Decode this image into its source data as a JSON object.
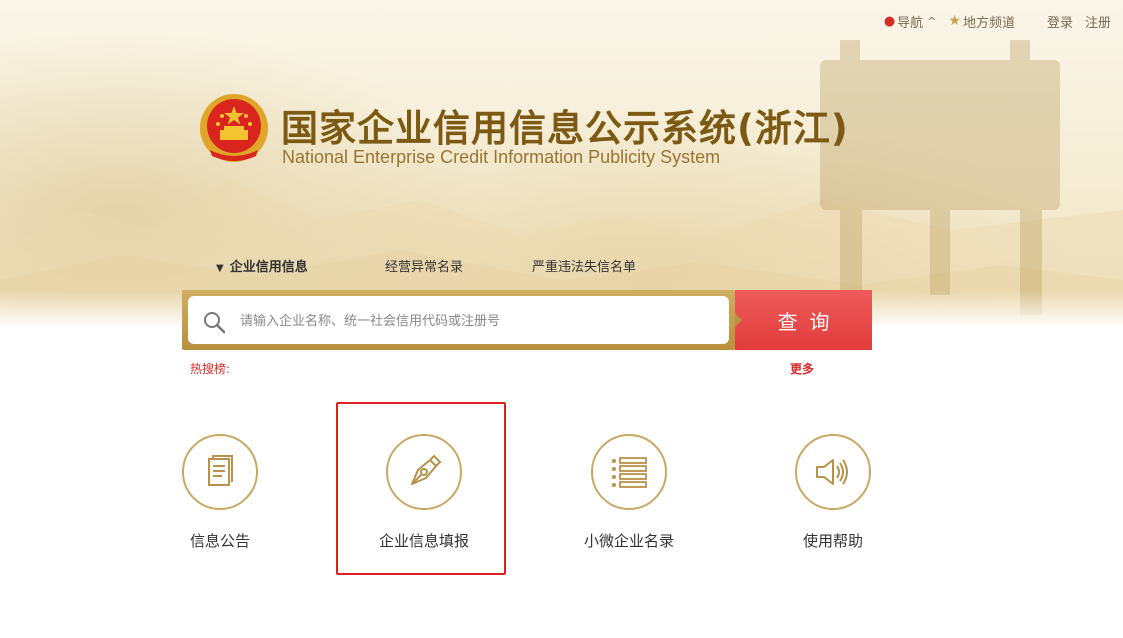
{
  "topbar": {
    "nav": "导航",
    "local": "地方频道",
    "login": "登录",
    "register": "注册"
  },
  "header": {
    "title_cn": "国家企业信用信息公示系统(浙江)",
    "title_en": "National Enterprise Credit Information Publicity System"
  },
  "tabs": [
    {
      "label": "企业信用信息",
      "active": true
    },
    {
      "label": "经营异常名录",
      "active": false
    },
    {
      "label": "严重违法失信名单",
      "active": false
    }
  ],
  "search": {
    "placeholder": "请输入企业名称、统一社会信用代码或注册号",
    "button": "查询"
  },
  "hot": {
    "label": "热搜榜:",
    "more": "更多"
  },
  "features": [
    {
      "label": "信息公告",
      "icon": "document-icon"
    },
    {
      "label": "企业信息填报",
      "icon": "pen-nib-icon",
      "highlighted": true
    },
    {
      "label": "小微企业名录",
      "icon": "list-icon"
    },
    {
      "label": "使用帮助",
      "icon": "speaker-icon"
    }
  ],
  "colors": {
    "gold": "#c9a864",
    "title_brown": "#7d5a14",
    "red": "#e23c3c",
    "highlight": "#e02020"
  }
}
